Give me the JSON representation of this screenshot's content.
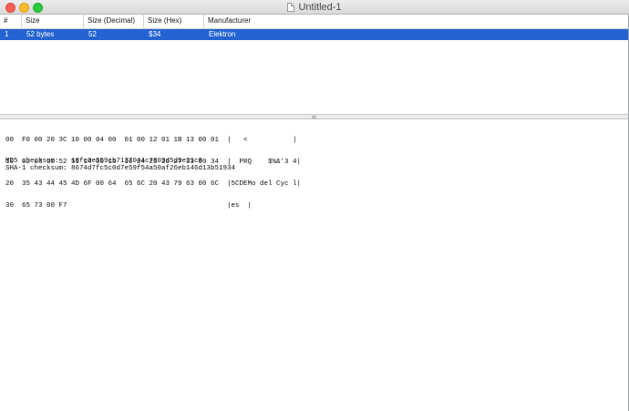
{
  "window": {
    "title": "Untitled-1"
  },
  "table": {
    "columns": [
      "#",
      "Size",
      "Size (Decimal)",
      "Size (Hex)",
      "Manufacturer"
    ],
    "rows": [
      {
        "index": "1",
        "size": "52 bytes",
        "size_decimal": "52",
        "size_hex": "$34",
        "manufacturer": "Elektron",
        "selected": true
      }
    ],
    "selection_color": "#2463d1"
  },
  "dump": {
    "lines": [
      "00  F0 00 20 3C 10 00 04 00  01 00 12 01 1B 13 00 01  |   <           |",
      "10  02 03 50 52 51 14 00 15  16 24 25 26 27 33 00 34  |  PRQ    $%&'3 4|",
      "20  35 43 44 45 4D 6F 00 64  65 6C 20 43 79 63 00 6C  |5CDEMo del Cyc l|",
      "30  65 73 00 F7                                       |es  |"
    ],
    "md5_label": "MD5 checksum:",
    "md5_value": "18fc0e559cb7137044c7303d5d9e21c8",
    "sha1_label": "SHA-1 checksum:",
    "sha1_value": "8674d7fc5c0d7e59f54a50af26eb146d13b51934"
  }
}
